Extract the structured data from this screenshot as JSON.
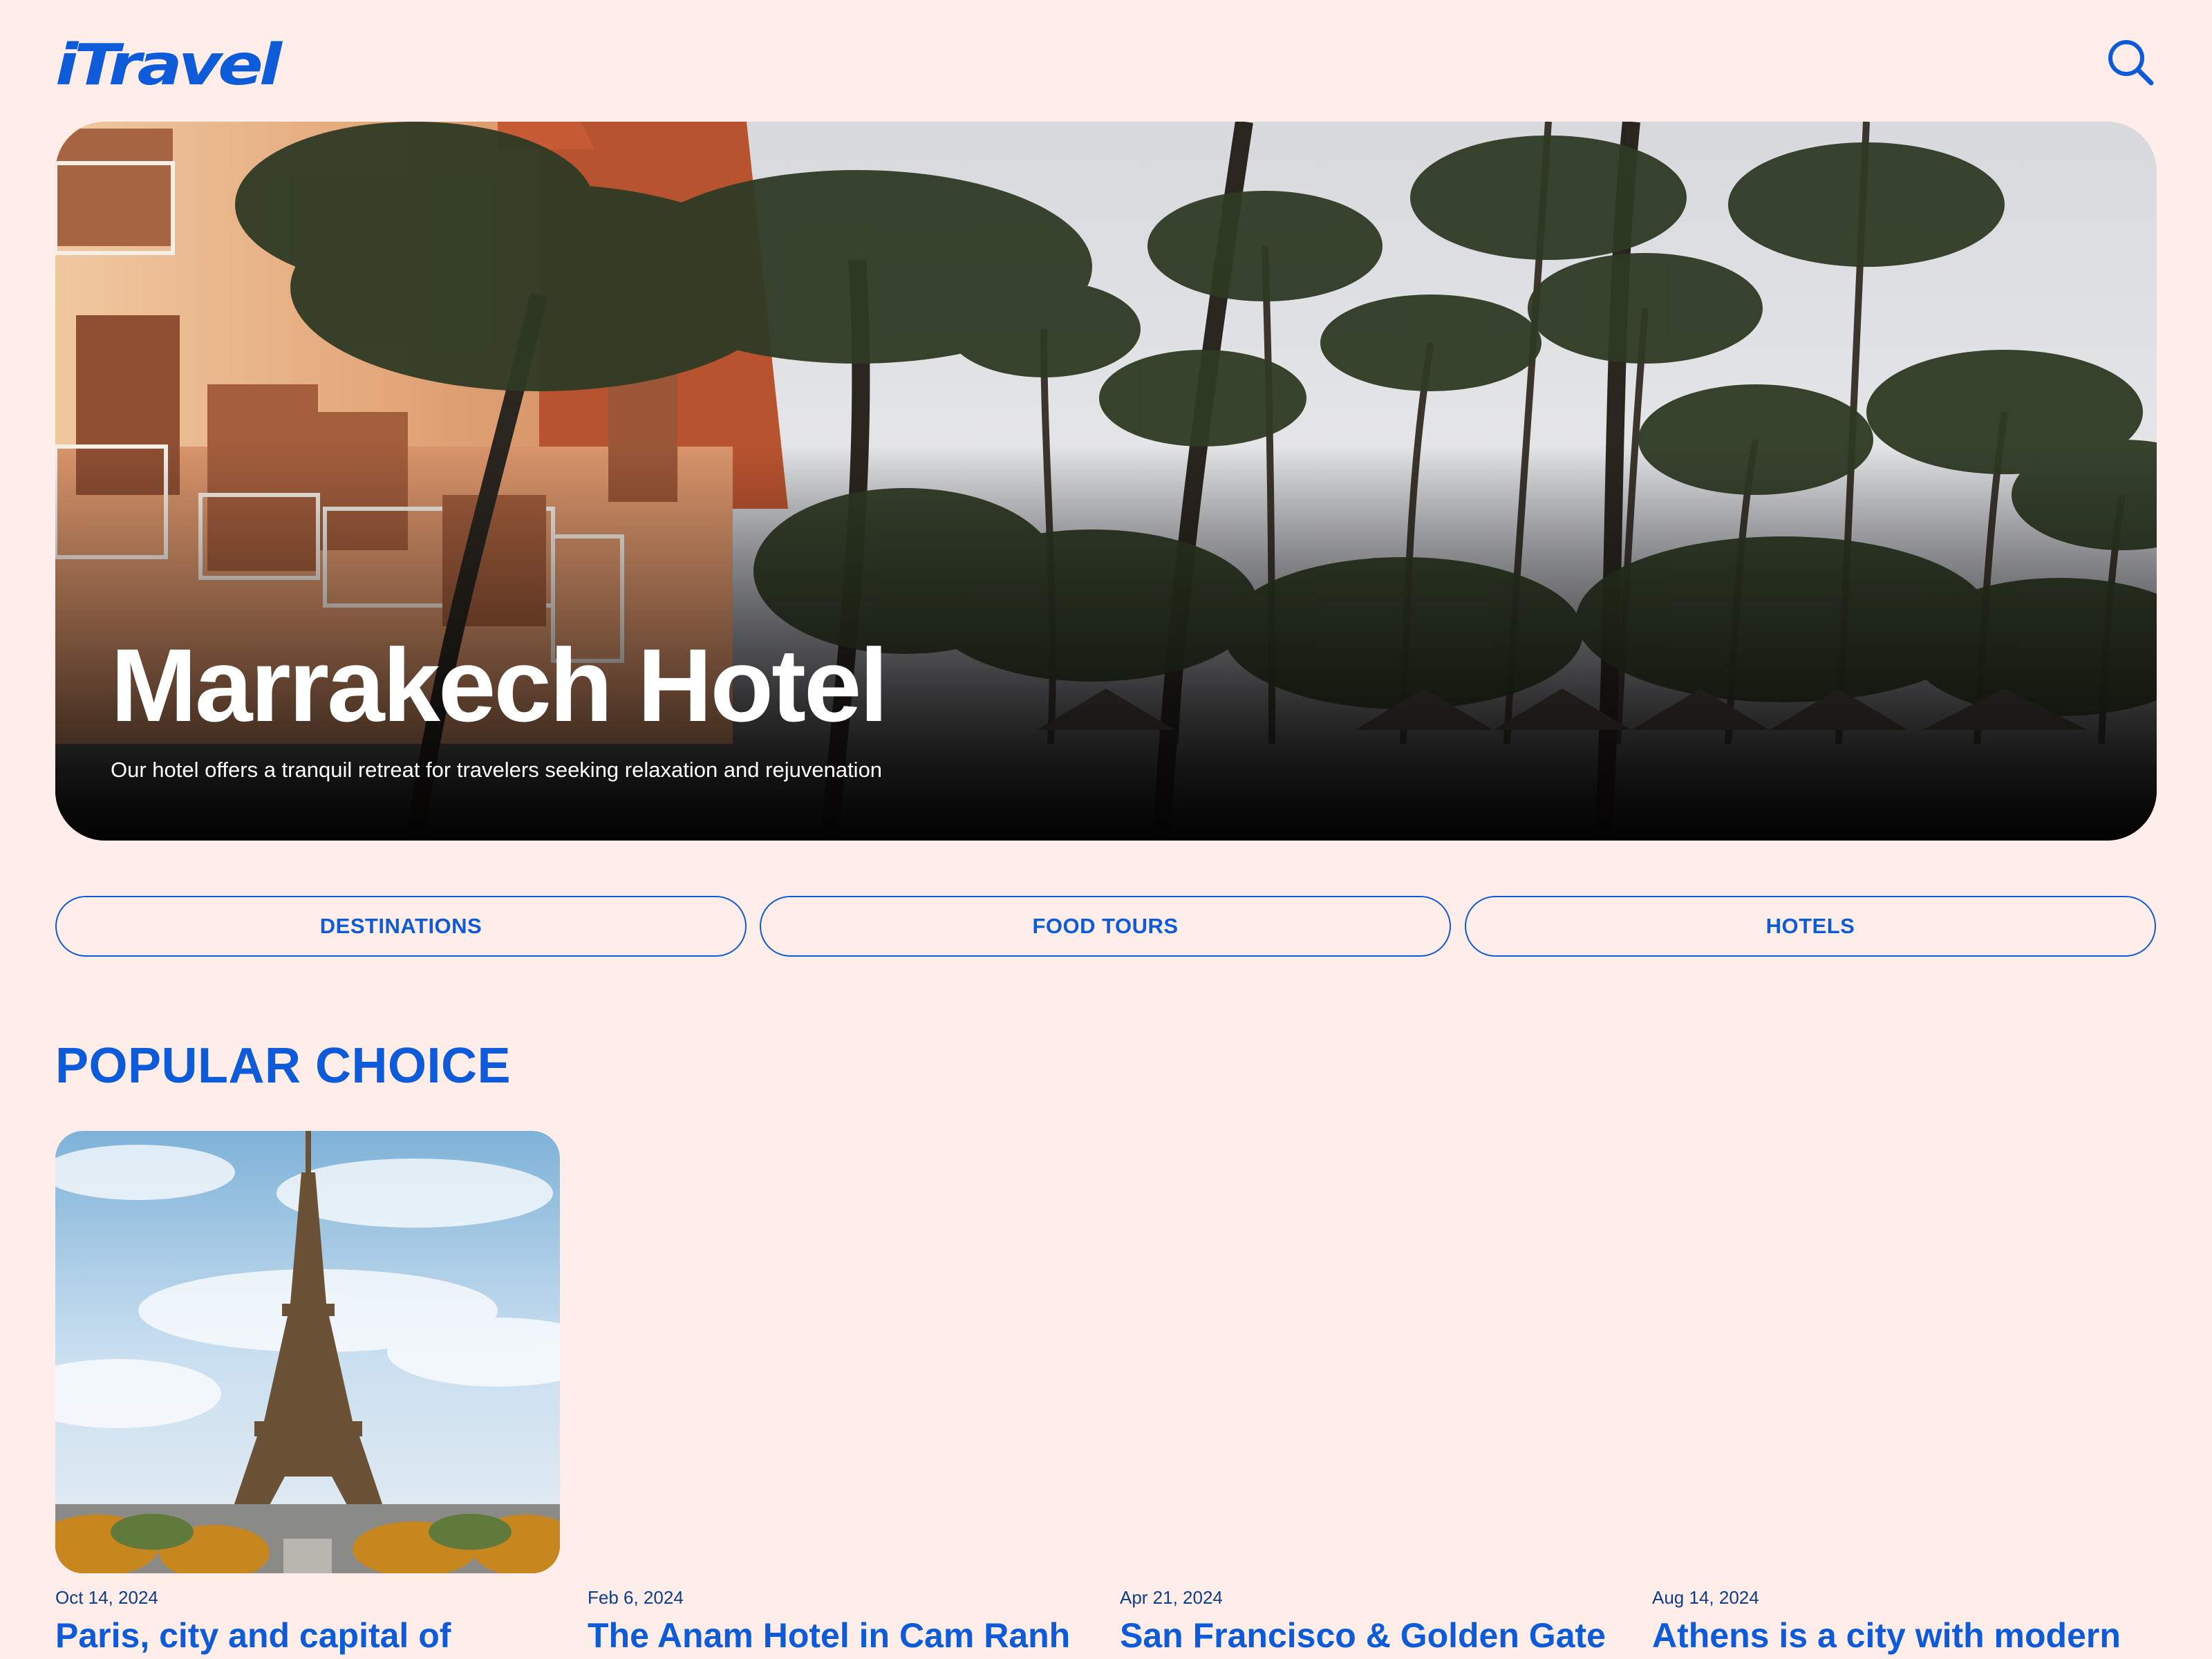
{
  "brand": {
    "logo_text": "iTravel",
    "accent_color": "#0D5BD8",
    "background_color": "#FFEDEA"
  },
  "header": {
    "search_icon": "search-icon"
  },
  "hero": {
    "title": "Marrakech Hotel",
    "subtitle": "Our hotel offers a tranquil retreat for travelers seeking relaxation and rejuvenation",
    "image": "hotel-palm-trees-photo"
  },
  "categories": [
    {
      "label": "DESTINATIONS"
    },
    {
      "label": "FOOD TOURS"
    },
    {
      "label": "HOTELS"
    }
  ],
  "popular": {
    "heading": "POPULAR CHOICE",
    "cards": [
      {
        "date": "Oct 14, 2024",
        "title": "Paris, city and capital of",
        "image": "eiffel-tower-photo"
      },
      {
        "date": "Feb 6, 2024",
        "title": "The Anam Hotel in Cam Ranh",
        "image": ""
      },
      {
        "date": "Apr 21, 2024",
        "title": "San Francisco & Golden Gate",
        "image": ""
      },
      {
        "date": "Aug 14, 2024",
        "title": "Athens is a city with modern",
        "image": ""
      }
    ]
  }
}
